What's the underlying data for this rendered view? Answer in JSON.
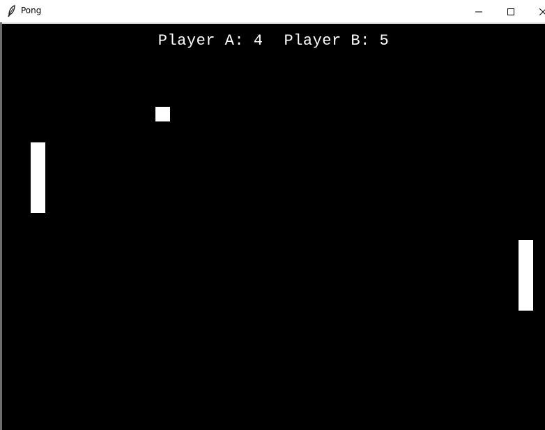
{
  "window": {
    "title": "Pong",
    "icon": "feather-icon",
    "controls": [
      "minimize-icon",
      "maximize-icon",
      "close-icon"
    ]
  },
  "game": {
    "background_color": "#000000",
    "foreground_color": "#ffffff",
    "score": {
      "player_a": "Player A: 4",
      "player_b": "Player B: 5"
    }
  }
}
